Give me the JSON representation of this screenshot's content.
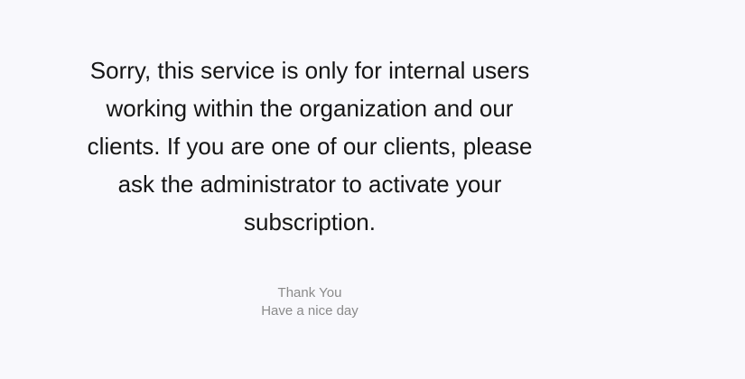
{
  "message": {
    "lines": [
      "Sorry, this service is only for internal users",
      "working within the organization and our",
      "clients. If you are one of our clients, please",
      "ask the administrator to activate your",
      "subscription."
    ]
  },
  "signoff": {
    "thank_you": "Thank You",
    "nice_day": "Have a nice day"
  },
  "colors": {
    "background": "#f8f8fc",
    "message_text": "#151515",
    "signoff_text": "#8a8a8a"
  }
}
